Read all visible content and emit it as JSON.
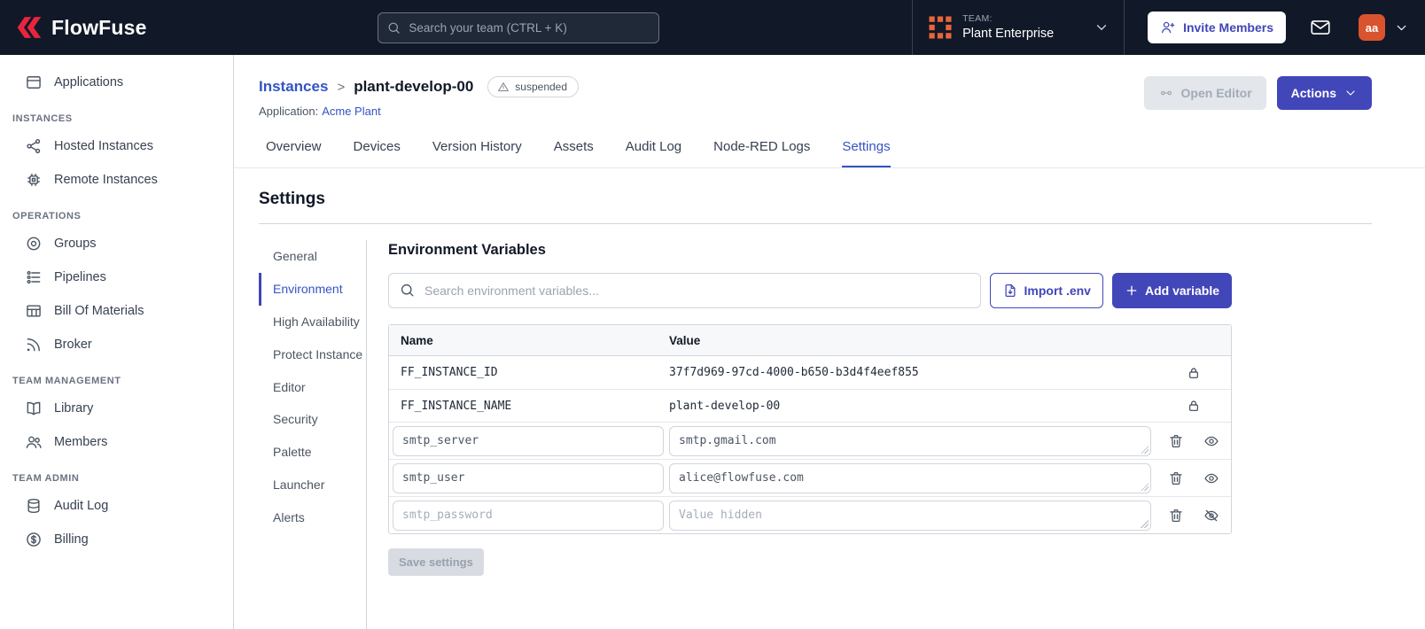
{
  "colors": {
    "navbar_bg": "#111827",
    "accent": "#4146b8",
    "link_blue": "#3354c4",
    "brand_red": "#e8243f",
    "avatar_bg": "#d9532f"
  },
  "navbar": {
    "brand": "FlowFuse",
    "search_placeholder": "Search your team (CTRL + K)",
    "team_label": "TEAM:",
    "team_name": "Plant Enterprise",
    "invite_button": "Invite Members",
    "avatar_initials": "aa"
  },
  "sidebar": {
    "top_items": [
      {
        "label": "Applications",
        "icon": "applications-icon"
      }
    ],
    "sections": [
      {
        "label": "INSTANCES",
        "items": [
          {
            "label": "Hosted Instances",
            "icon": "hosted-instances-icon"
          },
          {
            "label": "Remote Instances",
            "icon": "remote-instances-icon"
          }
        ]
      },
      {
        "label": "OPERATIONS",
        "items": [
          {
            "label": "Groups",
            "icon": "groups-icon"
          },
          {
            "label": "Pipelines",
            "icon": "pipelines-icon"
          },
          {
            "label": "Bill Of Materials",
            "icon": "bill-of-materials-icon"
          },
          {
            "label": "Broker",
            "icon": "broker-icon"
          }
        ]
      },
      {
        "label": "TEAM MANAGEMENT",
        "items": [
          {
            "label": "Library",
            "icon": "library-icon"
          },
          {
            "label": "Members",
            "icon": "members-icon"
          }
        ]
      },
      {
        "label": "TEAM ADMIN",
        "items": [
          {
            "label": "Audit Log",
            "icon": "audit-log-icon"
          },
          {
            "label": "Billing",
            "icon": "billing-icon"
          }
        ]
      }
    ]
  },
  "main": {
    "breadcrumb": {
      "parent": "Instances",
      "separator": ">",
      "current": "plant-develop-00",
      "status": "suspended"
    },
    "application_label": "Application:",
    "application_name": "Acme Plant",
    "open_editor_button": "Open Editor",
    "actions_button": "Actions",
    "tabs": [
      "Overview",
      "Devices",
      "Version History",
      "Assets",
      "Audit Log",
      "Node-RED Logs",
      "Settings"
    ],
    "active_tab": "Settings",
    "section_title": "Settings",
    "settings_nav": [
      "General",
      "Environment",
      "High Availability",
      "Protect Instance",
      "Editor",
      "Security",
      "Palette",
      "Launcher",
      "Alerts"
    ],
    "active_settings_nav": "Environment",
    "env": {
      "heading": "Environment Variables",
      "search_placeholder": "Search environment variables...",
      "import_button": "Import .env",
      "add_button": "Add variable",
      "save_button": "Save settings",
      "table": {
        "headers": [
          "Name",
          "Value"
        ],
        "rows": [
          {
            "name": "FF_INSTANCE_ID",
            "value": "37f7d969-97cd-4000-b650-b3d4f4eef855",
            "locked": true
          },
          {
            "name": "FF_INSTANCE_NAME",
            "value": "plant-develop-00",
            "locked": true
          },
          {
            "name": "smtp_server",
            "value": "smtp.gmail.com",
            "locked": false,
            "value_hidden": false
          },
          {
            "name": "smtp_user",
            "value": "alice@flowfuse.com",
            "locked": false,
            "value_hidden": false
          },
          {
            "name": "smtp_password",
            "value": "",
            "value_placeholder": "Value hidden",
            "locked": false,
            "value_hidden": true
          }
        ]
      }
    }
  }
}
